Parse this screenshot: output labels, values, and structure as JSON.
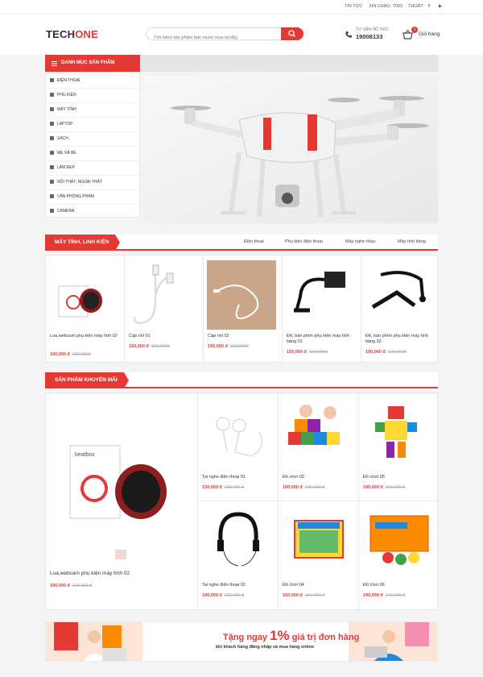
{
  "topbar": {
    "news": "TIN TỨC",
    "greeting": "XIN CHÀO: T003",
    "logout": "THOÁT"
  },
  "logo": {
    "part1": "TECH",
    "part2": "ONE"
  },
  "search": {
    "placeholder": "Tìm kiếm sản phẩm bạn muốn mua tại đây"
  },
  "hotline": {
    "label": "TƯ VẤN HỖ TRỢ",
    "number": "19008133"
  },
  "cart": {
    "count": "1",
    "label": "Giỏ hàng"
  },
  "categories": {
    "title": "Danh mục sản phẩm",
    "items": [
      "Điện thoại",
      "Phụ kiện",
      "Máy tính",
      "Laptop",
      "Sách",
      "Mẹ và bé",
      "Làm đẹp",
      "Nội thất, ngoại thất",
      "Văn phòng phẩm",
      "Camera"
    ]
  },
  "section1": {
    "title": "MÁY TÍNH, LINH KIỆN",
    "tabs": [
      "Điện thoại",
      "Phụ kiện điện thoại",
      "Máy nghe nhạc",
      "Máy tính bảng"
    ],
    "products": [
      {
        "name": "Loa,webcam phụ kiện máy tính 02",
        "price": "190,000 đ",
        "old": "220,000đ"
      },
      {
        "name": "Cáp nối 01",
        "price": "150,000 đ",
        "old": "190,000đ"
      },
      {
        "name": "Cáp nối 02",
        "price": "190,000 đ",
        "old": "220,000đ"
      },
      {
        "name": "Đế, bàn phím phụ kiện máy tính bảng 01",
        "price": "150,000 đ",
        "old": "190,000đ"
      },
      {
        "name": "Đế, bàn phím phụ kiện máy tính bảng 02",
        "price": "190,000 đ",
        "old": "220,000đ"
      }
    ]
  },
  "section2": {
    "title": "SẢN PHẨM KHUYẾN MÃI",
    "featured": {
      "name": "Loa,webcam phụ kiện máy tính 02",
      "price": "190,000 đ",
      "old": "220,000 đ"
    },
    "products": [
      {
        "name": "Tai nghe điện thoại 01",
        "price": "150,000 đ",
        "old": "190,000 đ"
      },
      {
        "name": "Đồ chơi 03",
        "price": "190,000 đ",
        "old": "220,000 đ"
      },
      {
        "name": "Đồ chơi 05",
        "price": "190,000 đ",
        "old": "222,000 đ"
      },
      {
        "name": "Tai nghe điện thoại 02",
        "price": "190,000 đ",
        "old": "220,000 đ"
      },
      {
        "name": "Đồ chơi 04",
        "price": "150,000 đ",
        "old": "160,000 đ"
      },
      {
        "name": "Đồ chơi 06",
        "price": "190,000 đ",
        "old": "240,000 đ"
      }
    ]
  },
  "ad": {
    "line1a": "Tặng ngay",
    "line1b": "1%",
    "line1c": "giá trị đơn hàng",
    "line2": "khi khách hàng đăng nhập và mua hàng online"
  },
  "colors": {
    "accent": "#e53935",
    "background": "#f4f4f4"
  }
}
